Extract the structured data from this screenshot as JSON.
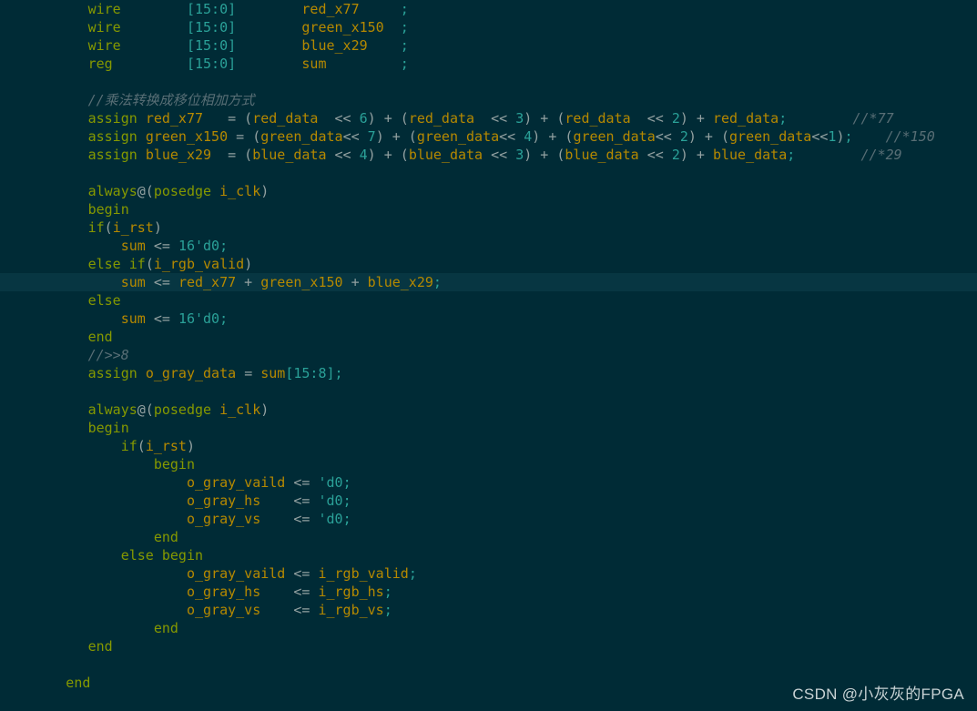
{
  "editor": {
    "background_color": "#002b36",
    "highlight_line_color": "#073642",
    "default_text_color": "#93a1a1",
    "palette": {
      "keyword": "#859900",
      "identifier": "#b58900",
      "number": "#2aa198",
      "punctuation": "#93a1a1",
      "comment": "#586e75"
    },
    "font_size_px": 15,
    "line_height_px": 20,
    "language": "Verilog"
  },
  "watermark": {
    "text": "CSDN @小灰灰的FPGA"
  },
  "code": {
    "highlighted_line_index": 15,
    "lines": [
      {
        "indent": 6,
        "highlight": false,
        "tokens": [
          {
            "t": "wire",
            "c": "kw"
          },
          {
            "t": "        ",
            "c": "plain"
          },
          {
            "t": "[15:0]",
            "c": "num"
          },
          {
            "t": "        ",
            "c": "plain"
          },
          {
            "t": "red_x77",
            "c": "id"
          },
          {
            "t": "     ",
            "c": "plain"
          },
          {
            "t": ";",
            "c": "num"
          }
        ]
      },
      {
        "indent": 6,
        "highlight": false,
        "tokens": [
          {
            "t": "wire",
            "c": "kw"
          },
          {
            "t": "        ",
            "c": "plain"
          },
          {
            "t": "[15:0]",
            "c": "num"
          },
          {
            "t": "        ",
            "c": "plain"
          },
          {
            "t": "green_x150",
            "c": "id"
          },
          {
            "t": "  ",
            "c": "plain"
          },
          {
            "t": ";",
            "c": "num"
          }
        ]
      },
      {
        "indent": 6,
        "highlight": false,
        "tokens": [
          {
            "t": "wire",
            "c": "kw"
          },
          {
            "t": "        ",
            "c": "plain"
          },
          {
            "t": "[15:0]",
            "c": "num"
          },
          {
            "t": "        ",
            "c": "plain"
          },
          {
            "t": "blue_x29",
            "c": "id"
          },
          {
            "t": "    ",
            "c": "plain"
          },
          {
            "t": ";",
            "c": "num"
          }
        ]
      },
      {
        "indent": 6,
        "highlight": false,
        "tokens": [
          {
            "t": "reg",
            "c": "kw"
          },
          {
            "t": "         ",
            "c": "plain"
          },
          {
            "t": "[15:0]",
            "c": "num"
          },
          {
            "t": "        ",
            "c": "plain"
          },
          {
            "t": "sum",
            "c": "id"
          },
          {
            "t": "         ",
            "c": "plain"
          },
          {
            "t": ";",
            "c": "num"
          }
        ]
      },
      {
        "indent": 0,
        "highlight": false,
        "tokens": []
      },
      {
        "indent": 6,
        "highlight": false,
        "tokens": [
          {
            "t": "//乘法转换成移位相加方式",
            "c": "cmt"
          }
        ]
      },
      {
        "indent": 6,
        "highlight": false,
        "tokens": [
          {
            "t": "assign",
            "c": "kw"
          },
          {
            "t": " ",
            "c": "plain"
          },
          {
            "t": "red_x77",
            "c": "id"
          },
          {
            "t": "   ",
            "c": "plain"
          },
          {
            "t": "= (",
            "c": "punct"
          },
          {
            "t": "red_data",
            "c": "id"
          },
          {
            "t": "  ",
            "c": "plain"
          },
          {
            "t": "<< ",
            "c": "punct"
          },
          {
            "t": "6",
            "c": "num"
          },
          {
            "t": ") + (",
            "c": "punct"
          },
          {
            "t": "red_data",
            "c": "id"
          },
          {
            "t": "  ",
            "c": "plain"
          },
          {
            "t": "<< ",
            "c": "punct"
          },
          {
            "t": "3",
            "c": "num"
          },
          {
            "t": ") + (",
            "c": "punct"
          },
          {
            "t": "red_data",
            "c": "id"
          },
          {
            "t": "  ",
            "c": "plain"
          },
          {
            "t": "<< ",
            "c": "punct"
          },
          {
            "t": "2",
            "c": "num"
          },
          {
            "t": ") + ",
            "c": "punct"
          },
          {
            "t": "red_data",
            "c": "id"
          },
          {
            "t": ";",
            "c": "num"
          },
          {
            "t": "        ",
            "c": "plain"
          },
          {
            "t": "//*77",
            "c": "cmt"
          }
        ]
      },
      {
        "indent": 6,
        "highlight": false,
        "tokens": [
          {
            "t": "assign",
            "c": "kw"
          },
          {
            "t": " ",
            "c": "plain"
          },
          {
            "t": "green_x150",
            "c": "id"
          },
          {
            "t": " ",
            "c": "plain"
          },
          {
            "t": "= (",
            "c": "punct"
          },
          {
            "t": "green_data",
            "c": "id"
          },
          {
            "t": "<< ",
            "c": "punct"
          },
          {
            "t": "7",
            "c": "num"
          },
          {
            "t": ") + (",
            "c": "punct"
          },
          {
            "t": "green_data",
            "c": "id"
          },
          {
            "t": "<< ",
            "c": "punct"
          },
          {
            "t": "4",
            "c": "num"
          },
          {
            "t": ") + (",
            "c": "punct"
          },
          {
            "t": "green_data",
            "c": "id"
          },
          {
            "t": "<< ",
            "c": "punct"
          },
          {
            "t": "2",
            "c": "num"
          },
          {
            "t": ") + (",
            "c": "punct"
          },
          {
            "t": "green_data",
            "c": "id"
          },
          {
            "t": "<<",
            "c": "punct"
          },
          {
            "t": "1",
            "c": "num"
          },
          {
            "t": ")",
            "c": "punct"
          },
          {
            "t": ";",
            "c": "num"
          },
          {
            "t": "    ",
            "c": "plain"
          },
          {
            "t": "//*150",
            "c": "cmt"
          }
        ]
      },
      {
        "indent": 6,
        "highlight": false,
        "tokens": [
          {
            "t": "assign",
            "c": "kw"
          },
          {
            "t": " ",
            "c": "plain"
          },
          {
            "t": "blue_x29",
            "c": "id"
          },
          {
            "t": "  ",
            "c": "plain"
          },
          {
            "t": "= (",
            "c": "punct"
          },
          {
            "t": "blue_data",
            "c": "id"
          },
          {
            "t": " ",
            "c": "plain"
          },
          {
            "t": "<< ",
            "c": "punct"
          },
          {
            "t": "4",
            "c": "num"
          },
          {
            "t": ") + (",
            "c": "punct"
          },
          {
            "t": "blue_data",
            "c": "id"
          },
          {
            "t": " ",
            "c": "plain"
          },
          {
            "t": "<< ",
            "c": "punct"
          },
          {
            "t": "3",
            "c": "num"
          },
          {
            "t": ") + (",
            "c": "punct"
          },
          {
            "t": "blue_data",
            "c": "id"
          },
          {
            "t": " ",
            "c": "plain"
          },
          {
            "t": "<< ",
            "c": "punct"
          },
          {
            "t": "2",
            "c": "num"
          },
          {
            "t": ") + ",
            "c": "punct"
          },
          {
            "t": "blue_data",
            "c": "id"
          },
          {
            "t": ";",
            "c": "num"
          },
          {
            "t": "        ",
            "c": "plain"
          },
          {
            "t": "//*29",
            "c": "cmt"
          }
        ]
      },
      {
        "indent": 0,
        "highlight": false,
        "tokens": []
      },
      {
        "indent": 6,
        "highlight": false,
        "tokens": [
          {
            "t": "always",
            "c": "kw"
          },
          {
            "t": "@(",
            "c": "punct"
          },
          {
            "t": "posedge",
            "c": "kw"
          },
          {
            "t": " ",
            "c": "plain"
          },
          {
            "t": "i_clk",
            "c": "id"
          },
          {
            "t": ")",
            "c": "punct"
          }
        ]
      },
      {
        "indent": 6,
        "highlight": false,
        "tokens": [
          {
            "t": "begin",
            "c": "kw"
          }
        ]
      },
      {
        "indent": 6,
        "highlight": false,
        "tokens": [
          {
            "t": "if",
            "c": "kw"
          },
          {
            "t": "(",
            "c": "punct"
          },
          {
            "t": "i_rst",
            "c": "id"
          },
          {
            "t": ")",
            "c": "punct"
          }
        ]
      },
      {
        "indent": 6,
        "highlight": false,
        "tokens": [
          {
            "t": "    ",
            "c": "plain"
          },
          {
            "t": "sum",
            "c": "id"
          },
          {
            "t": " ",
            "c": "plain"
          },
          {
            "t": "<= ",
            "c": "punct"
          },
          {
            "t": "16'd0",
            "c": "num"
          },
          {
            "t": ";",
            "c": "num"
          }
        ]
      },
      {
        "indent": 6,
        "highlight": false,
        "tokens": [
          {
            "t": "else",
            "c": "kw"
          },
          {
            "t": " ",
            "c": "plain"
          },
          {
            "t": "if",
            "c": "kw"
          },
          {
            "t": "(",
            "c": "punct"
          },
          {
            "t": "i_rgb_valid",
            "c": "id"
          },
          {
            "t": ")",
            "c": "punct"
          }
        ]
      },
      {
        "indent": 6,
        "highlight": true,
        "tokens": [
          {
            "t": "    ",
            "c": "plain"
          },
          {
            "t": "sum",
            "c": "id"
          },
          {
            "t": " ",
            "c": "plain"
          },
          {
            "t": "<= ",
            "c": "punct"
          },
          {
            "t": "red_x77",
            "c": "id"
          },
          {
            "t": " + ",
            "c": "punct"
          },
          {
            "t": "green_x150",
            "c": "id"
          },
          {
            "t": " + ",
            "c": "punct"
          },
          {
            "t": "blue_x29",
            "c": "id"
          },
          {
            "t": ";",
            "c": "num"
          }
        ]
      },
      {
        "indent": 6,
        "highlight": false,
        "tokens": [
          {
            "t": "else",
            "c": "kw"
          }
        ]
      },
      {
        "indent": 6,
        "highlight": false,
        "tokens": [
          {
            "t": "    ",
            "c": "plain"
          },
          {
            "t": "sum",
            "c": "id"
          },
          {
            "t": " ",
            "c": "plain"
          },
          {
            "t": "<= ",
            "c": "punct"
          },
          {
            "t": "16'd0",
            "c": "num"
          },
          {
            "t": ";",
            "c": "num"
          }
        ]
      },
      {
        "indent": 6,
        "highlight": false,
        "tokens": [
          {
            "t": "end",
            "c": "kw"
          }
        ]
      },
      {
        "indent": 6,
        "highlight": false,
        "tokens": [
          {
            "t": "//>>8",
            "c": "cmt"
          }
        ]
      },
      {
        "indent": 6,
        "highlight": false,
        "tokens": [
          {
            "t": "assign",
            "c": "kw"
          },
          {
            "t": " ",
            "c": "plain"
          },
          {
            "t": "o_gray_data",
            "c": "id"
          },
          {
            "t": " ",
            "c": "plain"
          },
          {
            "t": "= ",
            "c": "punct"
          },
          {
            "t": "sum",
            "c": "id"
          },
          {
            "t": "[15:8]",
            "c": "num"
          },
          {
            "t": ";",
            "c": "num"
          }
        ]
      },
      {
        "indent": 0,
        "highlight": false,
        "tokens": []
      },
      {
        "indent": 6,
        "highlight": false,
        "tokens": [
          {
            "t": "always",
            "c": "kw"
          },
          {
            "t": "@(",
            "c": "punct"
          },
          {
            "t": "posedge",
            "c": "kw"
          },
          {
            "t": " ",
            "c": "plain"
          },
          {
            "t": "i_clk",
            "c": "id"
          },
          {
            "t": ")",
            "c": "punct"
          }
        ]
      },
      {
        "indent": 6,
        "highlight": false,
        "tokens": [
          {
            "t": "begin",
            "c": "kw"
          }
        ]
      },
      {
        "indent": 6,
        "highlight": false,
        "tokens": [
          {
            "t": "    ",
            "c": "plain"
          },
          {
            "t": "if",
            "c": "kw"
          },
          {
            "t": "(",
            "c": "punct"
          },
          {
            "t": "i_rst",
            "c": "id"
          },
          {
            "t": ")",
            "c": "punct"
          }
        ]
      },
      {
        "indent": 6,
        "highlight": false,
        "tokens": [
          {
            "t": "        ",
            "c": "plain"
          },
          {
            "t": "begin",
            "c": "kw"
          }
        ]
      },
      {
        "indent": 6,
        "highlight": false,
        "tokens": [
          {
            "t": "            ",
            "c": "plain"
          },
          {
            "t": "o_gray_vaild",
            "c": "id"
          },
          {
            "t": " ",
            "c": "plain"
          },
          {
            "t": "<= ",
            "c": "punct"
          },
          {
            "t": "'d0",
            "c": "num"
          },
          {
            "t": ";",
            "c": "num"
          }
        ]
      },
      {
        "indent": 6,
        "highlight": false,
        "tokens": [
          {
            "t": "            ",
            "c": "plain"
          },
          {
            "t": "o_gray_hs",
            "c": "id"
          },
          {
            "t": "    ",
            "c": "plain"
          },
          {
            "t": "<= ",
            "c": "punct"
          },
          {
            "t": "'d0",
            "c": "num"
          },
          {
            "t": ";",
            "c": "num"
          }
        ]
      },
      {
        "indent": 6,
        "highlight": false,
        "tokens": [
          {
            "t": "            ",
            "c": "plain"
          },
          {
            "t": "o_gray_vs",
            "c": "id"
          },
          {
            "t": "    ",
            "c": "plain"
          },
          {
            "t": "<= ",
            "c": "punct"
          },
          {
            "t": "'d0",
            "c": "num"
          },
          {
            "t": ";",
            "c": "num"
          }
        ]
      },
      {
        "indent": 6,
        "highlight": false,
        "tokens": [
          {
            "t": "        ",
            "c": "plain"
          },
          {
            "t": "end",
            "c": "kw"
          }
        ]
      },
      {
        "indent": 6,
        "highlight": false,
        "tokens": [
          {
            "t": "    ",
            "c": "plain"
          },
          {
            "t": "else",
            "c": "kw"
          },
          {
            "t": " ",
            "c": "plain"
          },
          {
            "t": "begin",
            "c": "kw"
          }
        ]
      },
      {
        "indent": 6,
        "highlight": false,
        "tokens": [
          {
            "t": "            ",
            "c": "plain"
          },
          {
            "t": "o_gray_vaild",
            "c": "id"
          },
          {
            "t": " ",
            "c": "plain"
          },
          {
            "t": "<= ",
            "c": "punct"
          },
          {
            "t": "i_rgb_valid",
            "c": "id"
          },
          {
            "t": ";",
            "c": "num"
          }
        ]
      },
      {
        "indent": 6,
        "highlight": false,
        "tokens": [
          {
            "t": "            ",
            "c": "plain"
          },
          {
            "t": "o_gray_hs",
            "c": "id"
          },
          {
            "t": "    ",
            "c": "plain"
          },
          {
            "t": "<= ",
            "c": "punct"
          },
          {
            "t": "i_rgb_hs",
            "c": "id"
          },
          {
            "t": ";",
            "c": "num"
          }
        ]
      },
      {
        "indent": 6,
        "highlight": false,
        "tokens": [
          {
            "t": "            ",
            "c": "plain"
          },
          {
            "t": "o_gray_vs",
            "c": "id"
          },
          {
            "t": "    ",
            "c": "plain"
          },
          {
            "t": "<= ",
            "c": "punct"
          },
          {
            "t": "i_rgb_vs",
            "c": "id"
          },
          {
            "t": ";",
            "c": "num"
          }
        ]
      },
      {
        "indent": 6,
        "highlight": false,
        "tokens": [
          {
            "t": "        ",
            "c": "plain"
          },
          {
            "t": "end",
            "c": "kw"
          }
        ]
      },
      {
        "indent": 6,
        "highlight": false,
        "tokens": [
          {
            "t": "end",
            "c": "kw"
          }
        ]
      },
      {
        "indent": 0,
        "highlight": false,
        "tokens": []
      },
      {
        "indent": 3,
        "highlight": false,
        "tokens": [
          {
            "t": "end",
            "c": "kw"
          }
        ]
      }
    ]
  }
}
